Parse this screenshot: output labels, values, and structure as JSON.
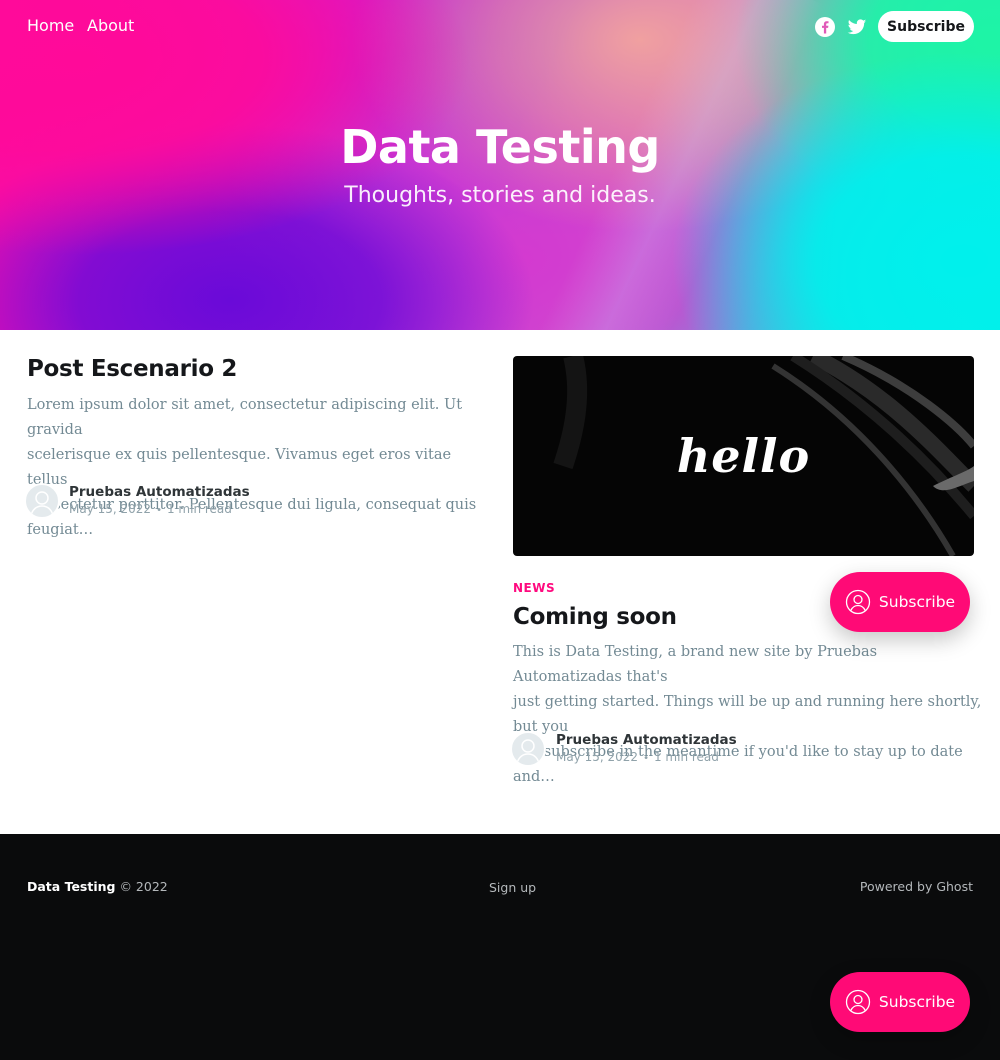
{
  "header": {
    "nav": [
      "Home",
      "About"
    ],
    "social_icons": [
      "facebook-icon",
      "twitter-icon"
    ],
    "subscribe_label": "Subscribe",
    "site_title": "Data Testing",
    "site_description": "Thoughts, stories and ideas."
  },
  "posts": [
    {
      "title": "Post Escenario 2",
      "excerpt_lines": [
        "Lorem ipsum dolor sit amet, consectetur adipiscing elit. Ut gravida",
        "scelerisque ex quis pellentesque. Vivamus eget eros vitae tellus",
        "consectetur porttitor. Pellentesque dui ligula, consequat quis feugiat…"
      ],
      "author": "Pruebas Automatizadas",
      "date": "May 15, 2022",
      "read_time": "1 min read"
    },
    {
      "image_text": "hello",
      "tag": "NEWS",
      "title": "Coming soon",
      "excerpt_lines": [
        "This is Data Testing, a brand new site by Pruebas Automatizadas that's",
        "just getting started. Things will be up and running here shortly, but you",
        "can subscribe in the meantime if you'd like to stay up to date and…"
      ],
      "author": "Pruebas Automatizadas",
      "date": "May 15, 2022",
      "read_time": "1 min read"
    }
  ],
  "floating_subscribe": {
    "label": "Subscribe",
    "icon": "user-circle-icon",
    "color": "#ff0a76"
  },
  "footer": {
    "site_name": "Data Testing",
    "copyright": "© 2022",
    "signup": "Sign up",
    "powered_by": "Powered by Ghost"
  },
  "colors": {
    "accent": "#ff0a7f",
    "footer_bg": "#0a0b0c",
    "excerpt_text": "#738a94"
  }
}
